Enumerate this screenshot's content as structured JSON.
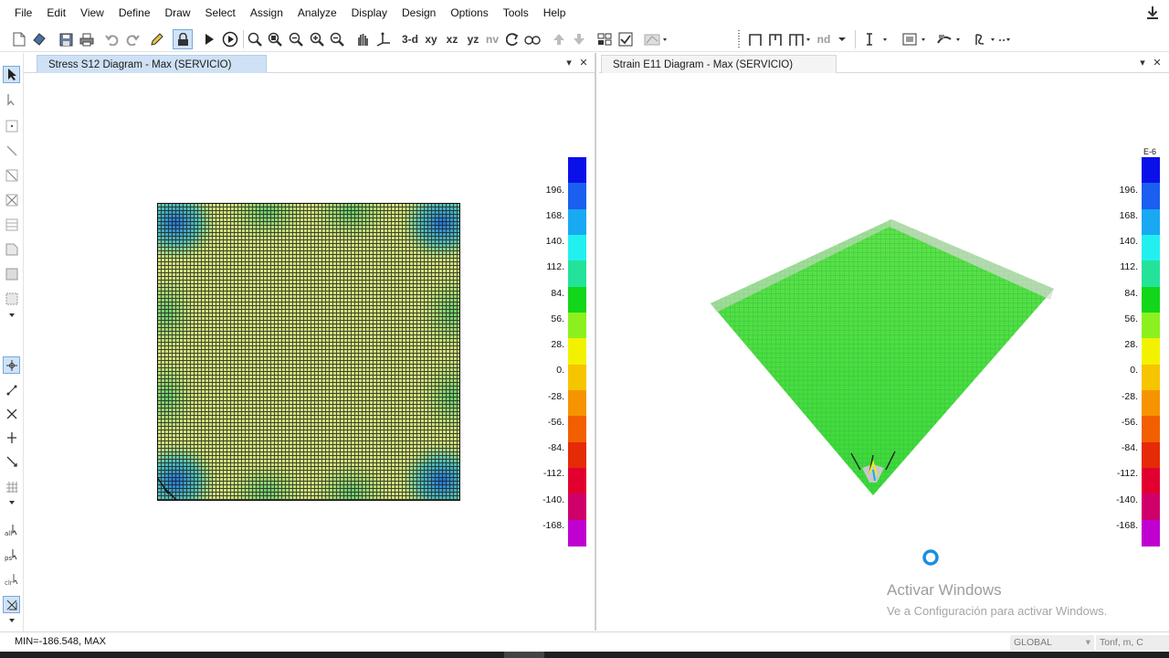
{
  "menu": [
    "File",
    "Edit",
    "View",
    "Define",
    "Draw",
    "Select",
    "Assign",
    "Analyze",
    "Display",
    "Design",
    "Options",
    "Tools",
    "Help"
  ],
  "toolbar": {
    "view_3d": "3-d",
    "view_xy": "xy",
    "view_xz": "xz",
    "view_yz": "yz",
    "view_nv": "nv",
    "nd": "nd"
  },
  "panels": {
    "left": {
      "tab_title": "Stress S12 Diagram - Max  (SERVICIO)",
      "scale_labels": [
        "196.",
        "168.",
        "140.",
        "112.",
        "84.",
        "56.",
        "28.",
        "0.",
        "-28.",
        "-56.",
        "-84.",
        "-112.",
        "-140.",
        "-168."
      ]
    },
    "right": {
      "tab_title": "Strain E11 Diagram - Max  (SERVICIO)",
      "scale_unit": "E-6",
      "scale_labels": [
        "196.",
        "168.",
        "140.",
        "112.",
        "84.",
        "56.",
        "28.",
        "0.",
        "-28.",
        "-56.",
        "-84.",
        "-112.",
        "-140.",
        "-168."
      ]
    }
  },
  "scale_colors": [
    "#0a10e8",
    "#1a5ff0",
    "#18a9f2",
    "#22f0f0",
    "#23e39a",
    "#12d61a",
    "#8cf01e",
    "#f2f200",
    "#f6c400",
    "#f69400",
    "#f25f00",
    "#e52a08",
    "#e2002e",
    "#d0006a",
    "#c000d0"
  ],
  "watermark": {
    "title": "Activar Windows",
    "subtitle": "Ve a Configuración para activar Windows."
  },
  "status": {
    "text": "MIN=-186.548, MAX",
    "coord_system": "GLOBAL",
    "units": "Tonf, m, C"
  }
}
